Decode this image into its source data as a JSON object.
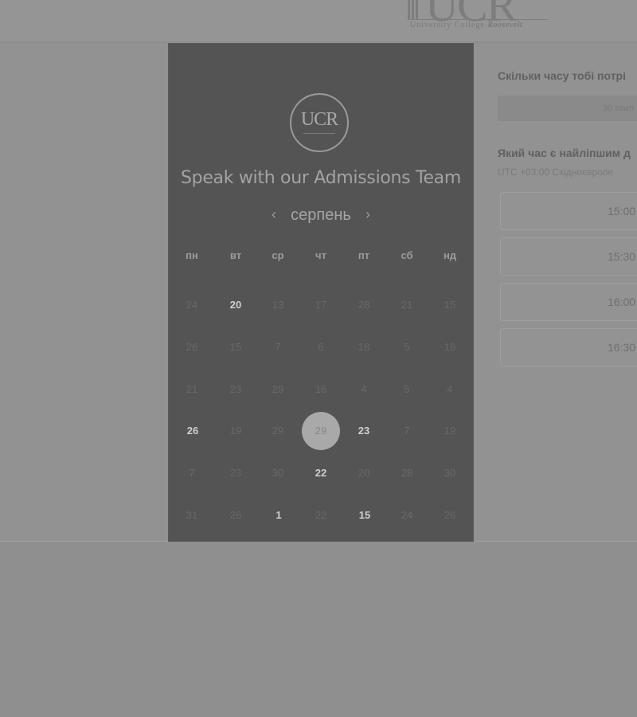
{
  "brand": {
    "letters": "UCR",
    "tagline_prefix": "University College",
    "tagline_suffix": "Roosevelt"
  },
  "calendar": {
    "logo_text": "UCR",
    "title": "Speak with our Admissions Team",
    "month": "серпень",
    "prev_arrow": "‹",
    "next_arrow": "›",
    "weekdays": [
      "пн",
      "вт",
      "ср",
      "чт",
      "пт",
      "сб",
      "нд"
    ],
    "rows": [
      [
        "24",
        "20",
        "13",
        "17",
        "28",
        "21",
        "15"
      ],
      [
        "26",
        "15",
        "7",
        "6",
        "18",
        "5",
        "16"
      ],
      [
        "21",
        "23",
        "29",
        "16",
        "4",
        "5",
        "4"
      ],
      [
        "26",
        "19",
        "29",
        "29",
        "23",
        "7",
        "19"
      ],
      [
        "7",
        "23",
        "30",
        "22",
        "20",
        "28",
        "30"
      ],
      [
        "31",
        "26",
        "1",
        "22",
        "15",
        "24",
        "26"
      ]
    ],
    "selected_date": "29"
  },
  "booking": {
    "duration_question": "Скільки часу тобі потрі",
    "duration_value": "30 хвил",
    "time_question": "Який час є найліпшим д",
    "timezone": "UTC +03:00 Східноєвропе",
    "slots": [
      "15:00",
      "15:30",
      "16:00",
      "16:30"
    ]
  }
}
